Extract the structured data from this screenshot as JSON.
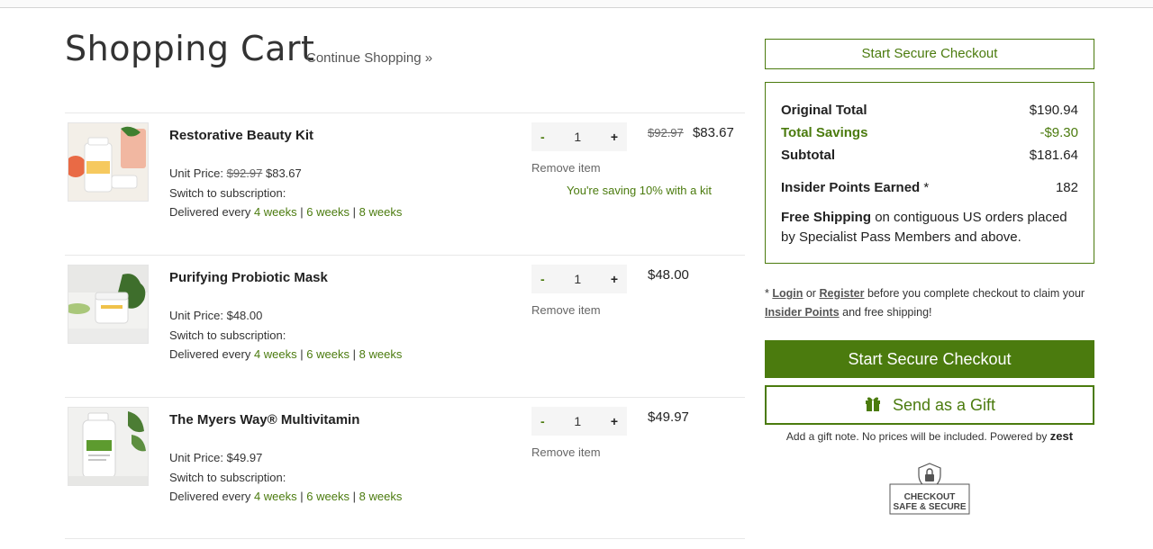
{
  "header": {
    "title": "Shopping Cart",
    "continue_label": "Continue Shopping »"
  },
  "items": [
    {
      "name": "Restorative Beauty Kit",
      "unit_price_label": "Unit Price:",
      "unit_price_old": "$92.97",
      "unit_price": "$83.67",
      "subscription_label": "Switch to subscription:",
      "delivered_label": "Delivered every",
      "frequencies": [
        "4 weeks",
        "6 weeks",
        "8 weeks"
      ],
      "quantity": "1",
      "remove_label": "Remove item",
      "price_old": "$92.97",
      "price": "$83.67",
      "note": "You're saving 10% with a kit"
    },
    {
      "name": "Purifying Probiotic Mask",
      "unit_price_label": "Unit Price:",
      "unit_price": "$48.00",
      "subscription_label": "Switch to subscription:",
      "delivered_label": "Delivered every",
      "frequencies": [
        "4 weeks",
        "6 weeks",
        "8 weeks"
      ],
      "quantity": "1",
      "remove_label": "Remove item",
      "price": "$48.00"
    },
    {
      "name": "The Myers Way® Multivitamin",
      "unit_price_label": "Unit Price:",
      "unit_price": "$49.97",
      "subscription_label": "Switch to subscription:",
      "delivered_label": "Delivered every",
      "frequencies": [
        "4 weeks",
        "6 weeks",
        "8 weeks"
      ],
      "quantity": "1",
      "remove_label": "Remove item",
      "price": "$49.97"
    }
  ],
  "qty_controls": {
    "minus": "-",
    "plus": "+"
  },
  "frequency_separator": "|",
  "checkout": {
    "top_button": "Start Secure Checkout",
    "main_button": "Start Secure Checkout",
    "gift_button": "Send as a Gift",
    "gift_note": "Add a gift note. No prices will be included. Powered by",
    "gift_brand": "zest"
  },
  "summary": {
    "original_total_label": "Original Total",
    "original_total": "$190.94",
    "savings_label": "Total Savings",
    "savings": "-$9.30",
    "subtotal_label": "Subtotal",
    "subtotal": "$181.64",
    "points_label": "Insider Points Earned",
    "points_marker": "*",
    "points": "182",
    "shipping_bold": "Free Shipping",
    "shipping_rest": "on contiguous US orders placed by Specialist Pass Members and above."
  },
  "login_note": {
    "marker": "*",
    "login": "Login",
    "or": "or",
    "register": "Register",
    "middle": "before you complete checkout to claim your",
    "points_link": "Insider Points",
    "end": "and free shipping!"
  },
  "badge": {
    "line1": "CHECKOUT",
    "line2": "SAFE & SECURE"
  },
  "colors": {
    "accent": "#4b7b0e",
    "text": "#222222",
    "border": "#e8e8e8"
  }
}
